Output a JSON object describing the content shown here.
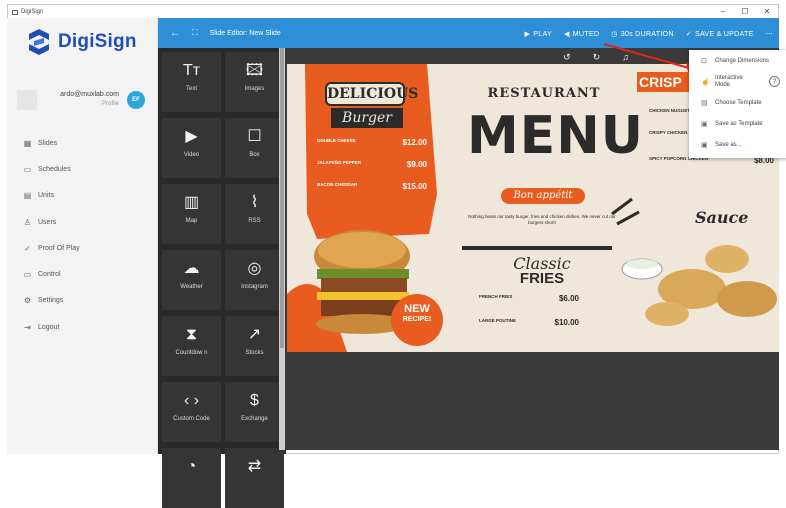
{
  "window": {
    "title": "DigiSign",
    "controls": [
      "–",
      "☐",
      "✕"
    ]
  },
  "brand": {
    "name": "DigiSign",
    "color": "#1f4fb4"
  },
  "user": {
    "email": "ardo@muxlab.com",
    "profile_label": "Profile",
    "initials": "EF"
  },
  "nav": {
    "items": [
      {
        "icon": "slides-icon",
        "glyph": "▦",
        "label": "Slides"
      },
      {
        "icon": "calendar-icon",
        "glyph": "▭",
        "label": "Schedules"
      },
      {
        "icon": "units-icon",
        "glyph": "▤",
        "label": "Units"
      },
      {
        "icon": "user-icon",
        "glyph": "♙",
        "label": "Users"
      },
      {
        "icon": "check-icon",
        "glyph": "✓",
        "label": "Proof Of Play"
      },
      {
        "icon": "monitor-icon",
        "glyph": "▭",
        "label": "Control"
      },
      {
        "icon": "gear-icon",
        "glyph": "⚙",
        "label": "Settings"
      },
      {
        "icon": "logout-icon",
        "glyph": "⇥",
        "label": "Logout"
      }
    ]
  },
  "topbar": {
    "title": "Slide Editor: New Slide",
    "play": "PLAY",
    "muted": "MUTED",
    "duration": "30s DURATION",
    "save": "SAVE & UPDATE",
    "more": "⋯",
    "color": "#2e8fd6"
  },
  "tools": [
    {
      "icon": "text-icon",
      "glyph": "Tт",
      "label": "Text"
    },
    {
      "icon": "images-icon",
      "glyph": "🖾",
      "label": "Images"
    },
    {
      "icon": "video-icon",
      "glyph": "▶",
      "label": "Video"
    },
    {
      "icon": "box-icon",
      "glyph": "☐",
      "label": "Box"
    },
    {
      "icon": "map-icon",
      "glyph": "▥",
      "label": "Map"
    },
    {
      "icon": "rss-icon",
      "glyph": "⌇",
      "label": "RSS"
    },
    {
      "icon": "weather-icon",
      "glyph": "☁",
      "label": "Weather"
    },
    {
      "icon": "instagram-icon",
      "glyph": "◎",
      "label": "Instagram"
    },
    {
      "icon": "hourglass-icon",
      "glyph": "⧗",
      "label": "Countdow n"
    },
    {
      "icon": "stocks-icon",
      "glyph": "↗",
      "label": "Stocks"
    },
    {
      "icon": "code-icon",
      "glyph": "‹ ›",
      "label": "Custom Code"
    },
    {
      "icon": "exchange-icon",
      "glyph": "$",
      "label": "Exchange"
    },
    {
      "icon": "clock-icon",
      "glyph": "◔",
      "label": ""
    },
    {
      "icon": "repeat-icon",
      "glyph": "⇄",
      "label": ""
    }
  ],
  "canvas_toolbar": [
    "↺",
    "↻",
    "♫"
  ],
  "dropdown": {
    "items": [
      {
        "icon": "crop-icon",
        "glyph": "⊡",
        "label": "Change Dimensions"
      },
      {
        "icon": "touch-icon",
        "glyph": "☝",
        "label": "Interactive Mode",
        "help": "?"
      },
      {
        "icon": "template-icon",
        "glyph": "▤",
        "label": "Choose Template"
      },
      {
        "icon": "save-icon",
        "glyph": "▣",
        "label": "Save as Template"
      },
      {
        "icon": "save-as-icon",
        "glyph": "▣",
        "label": "Save as..."
      }
    ]
  },
  "slide": {
    "background": "#efe7da",
    "accent": "#e85d1f",
    "dark": "#2b2b2b",
    "headline1": "DELICIOUS",
    "headline2": "Burger",
    "burgers": [
      {
        "name": "DOUBLE CHEESE",
        "price": "$12.00"
      },
      {
        "name": "JALAPEÑO PEPPER",
        "price": "$9.00"
      },
      {
        "name": "BACON CHEDDAR",
        "price": "$15.00"
      }
    ],
    "restaurant": "RESTAURANT",
    "menu": "MENU",
    "bon": "Bon appétit",
    "blurb": "Nothing beats our tasty burger, fries and chicken dishes. We never cut our burgers short!",
    "classic": "Classic",
    "fries": "FRIES",
    "fries_items": [
      {
        "name": "FRENCH FRIES",
        "price": "$6.00"
      },
      {
        "name": "LARGE POUTINE",
        "price": "$10.00"
      }
    ],
    "new1": "NEW",
    "new2": "RECIPE!",
    "crispy_label": "CRISP",
    "chicken_items": [
      {
        "name": "CHICKEN NUGGETS"
      },
      {
        "name": "CRISPY CHICKEN"
      },
      {
        "name": "SPICY POPCORN CHICKEN",
        "price": "$8.00"
      }
    ],
    "sauce": "Sauce"
  }
}
